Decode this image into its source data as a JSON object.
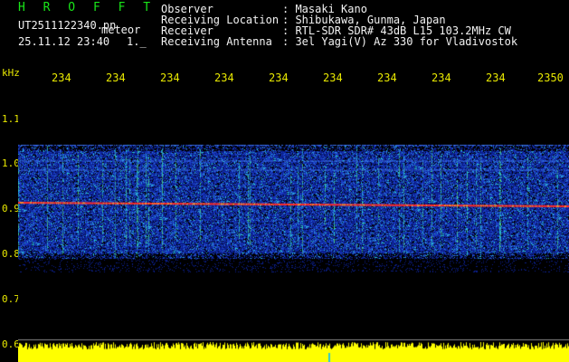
{
  "header": {
    "title": "H R O F F T",
    "filename": "UT2511122340.pn",
    "mode": "meteor",
    "datetime": "25.11.12 23:40",
    "flag": "1._",
    "observer_label": "Observer",
    "observer_value": ": Masaki Kano",
    "location_label": "Receiving Location",
    "location_value": ": Shibukawa, Gunma, Japan",
    "receiver_label": "Receiver",
    "receiver_value": ": RTL-SDR SDR# 43dB L15 103.2MHz CW",
    "antenna_label": "Receiving Antenna",
    "antenna_value": ": 3el Yagi(V) Az 330 for Vladivostok"
  },
  "axes": {
    "freq_unit": "kHz",
    "freq_ticks": [
      "1.1",
      "1.0",
      "0.9",
      "0.8",
      "0.7",
      "0.6"
    ],
    "time_ticks": [
      "234",
      "234",
      "234",
      "234",
      "234",
      "234",
      "234",
      "234",
      "234",
      "2350"
    ]
  },
  "chart_data": {
    "type": "heatmap",
    "description_free": true,
    "xlabel": "",
    "ylabel": "kHz",
    "x_ticks": [
      "234",
      "234",
      "234",
      "234",
      "234",
      "234",
      "234",
      "234",
      "234",
      "2350"
    ],
    "y_ticks": [
      1.1,
      1.0,
      0.9,
      0.8,
      0.7,
      0.6
    ],
    "ylim": [
      0.6,
      1.15
    ],
    "carrier_khz": 0.91,
    "noise_band_khz": [
      0.79,
      1.04
    ]
  },
  "colors": {
    "background": "#000000",
    "axis_text": "#e8e800",
    "title_green": "#19e619",
    "noise_blue": "#1a3dc8",
    "carrier_red": "#ff2a2a",
    "baseline_yellow": "#ffff00"
  }
}
